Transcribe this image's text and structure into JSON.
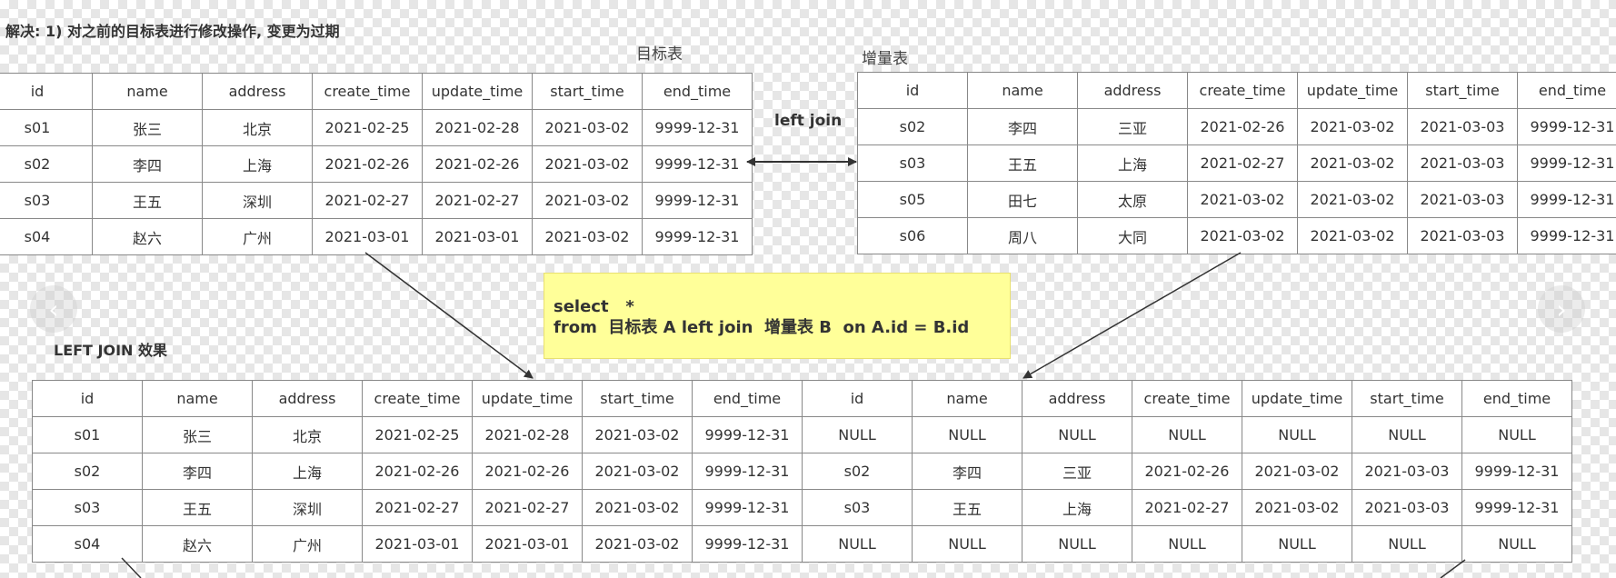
{
  "heading": "解决: 1) 对之前的目标表进行修改操作, 变更为过期",
  "target_table": {
    "title": "目标表",
    "columns": [
      "id",
      "name",
      "address",
      "create_time",
      "update_time",
      "start_time",
      "end_time"
    ],
    "rows": [
      [
        "s01",
        "张三",
        "北京",
        "2021-02-25",
        "2021-02-28",
        "2021-03-02",
        "9999-12-31"
      ],
      [
        "s02",
        "李四",
        "上海",
        "2021-02-26",
        "2021-02-26",
        "2021-03-02",
        "9999-12-31"
      ],
      [
        "s03",
        "王五",
        "深圳",
        "2021-02-27",
        "2021-02-27",
        "2021-03-02",
        "9999-12-31"
      ],
      [
        "s04",
        "赵六",
        "广州",
        "2021-03-01",
        "2021-03-01",
        "2021-03-02",
        "9999-12-31"
      ]
    ]
  },
  "incremental_table": {
    "title": "增量表",
    "columns": [
      "id",
      "name",
      "address",
      "create_time",
      "update_time",
      "start_time",
      "end_time"
    ],
    "rows": [
      [
        "s02",
        "李四",
        "三亚",
        "2021-02-26",
        "2021-03-02",
        "2021-03-03",
        "9999-12-31"
      ],
      [
        "s03",
        "王五",
        "上海",
        "2021-02-27",
        "2021-03-02",
        "2021-03-03",
        "9999-12-31"
      ],
      [
        "s05",
        "田七",
        "太原",
        "2021-03-02",
        "2021-03-02",
        "2021-03-03",
        "9999-12-31"
      ],
      [
        "s06",
        "周八",
        "大同",
        "2021-03-02",
        "2021-03-02",
        "2021-03-03",
        "9999-12-31"
      ]
    ]
  },
  "join_label": "left join",
  "sql": {
    "line1": "select   *",
    "line2": "from  目标表 A left join  增量表 B  on A.id = B.id"
  },
  "result_table": {
    "title": "LEFT JOIN 效果",
    "columns": [
      "id",
      "name",
      "address",
      "create_time",
      "update_time",
      "start_time",
      "end_time",
      "id",
      "name",
      "address",
      "create_time",
      "update_time",
      "start_time",
      "end_time"
    ],
    "rows": [
      [
        "s01",
        "张三",
        "北京",
        "2021-02-25",
        "2021-02-28",
        "2021-03-02",
        "9999-12-31",
        "NULL",
        "NULL",
        "NULL",
        "NULL",
        "NULL",
        "NULL",
        "NULL"
      ],
      [
        "s02",
        "李四",
        "上海",
        "2021-02-26",
        "2021-02-26",
        "2021-03-02",
        "9999-12-31",
        "s02",
        "李四",
        "三亚",
        "2021-02-26",
        "2021-03-02",
        "2021-03-03",
        "9999-12-31"
      ],
      [
        "s03",
        "王五",
        "深圳",
        "2021-02-27",
        "2021-02-27",
        "2021-03-02",
        "9999-12-31",
        "s03",
        "王五",
        "上海",
        "2021-02-27",
        "2021-03-02",
        "2021-03-03",
        "9999-12-31"
      ],
      [
        "s04",
        "赵六",
        "广州",
        "2021-03-01",
        "2021-03-01",
        "2021-03-02",
        "9999-12-31",
        "NULL",
        "NULL",
        "NULL",
        "NULL",
        "NULL",
        "NULL",
        "NULL"
      ]
    ]
  },
  "nav": {
    "prev_icon": "chevron-left-icon",
    "next_icon": "chevron-right-icon"
  },
  "colors": {
    "note_background": "#ffff99",
    "grid_line": "#888888",
    "arrow": "#333333"
  }
}
